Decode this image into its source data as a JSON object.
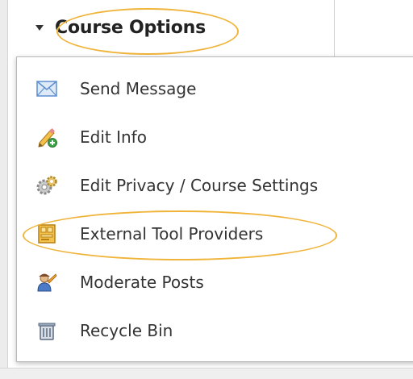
{
  "header": {
    "title": "Course Options"
  },
  "menu": {
    "items": [
      {
        "label": "Send Message",
        "icon": "envelope-icon"
      },
      {
        "label": "Edit Info",
        "icon": "pencil-add-icon"
      },
      {
        "label": "Edit Privacy / Course Settings",
        "icon": "gears-icon"
      },
      {
        "label": "External Tool Providers",
        "icon": "tool-panel-icon"
      },
      {
        "label": "Moderate Posts",
        "icon": "moderator-user-icon"
      },
      {
        "label": "Recycle Bin",
        "icon": "recycle-bin-icon"
      }
    ]
  },
  "colors": {
    "highlight": "#f0b43a",
    "menu_border": "#b8b8b8",
    "text": "#333333"
  }
}
